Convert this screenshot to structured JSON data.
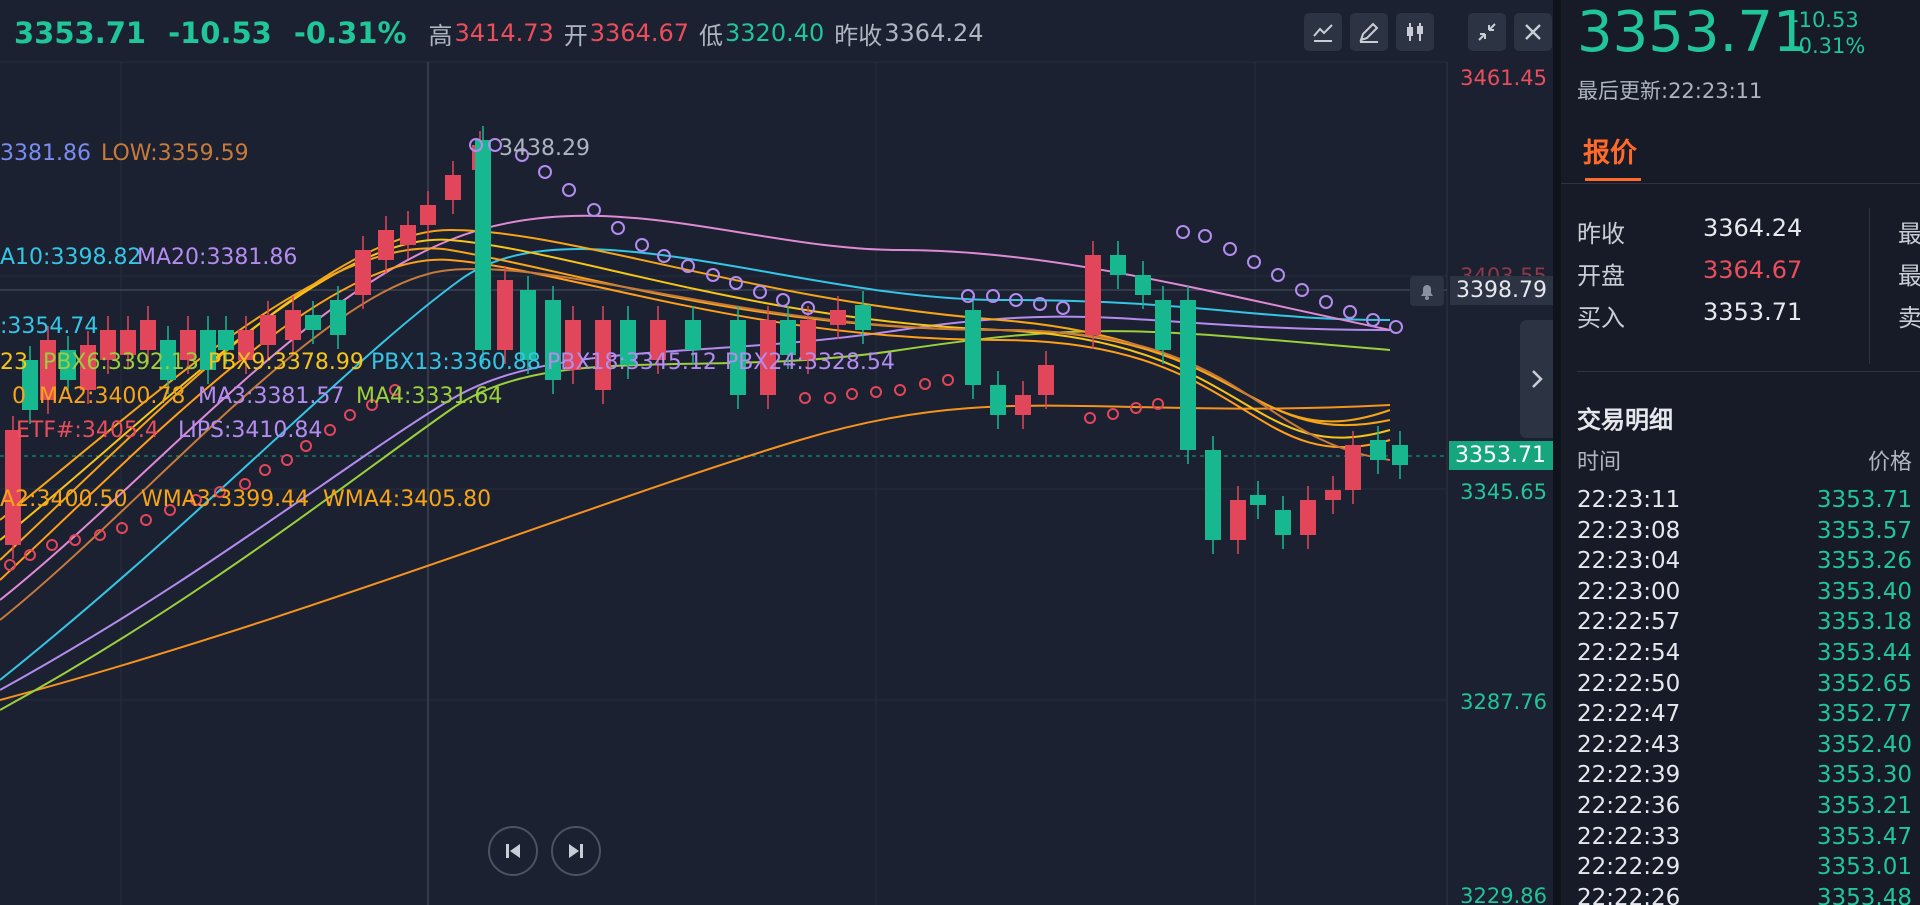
{
  "header": {
    "price": "3353.71",
    "change": "-10.53",
    "change_pct": "-0.31%",
    "high_label": "高",
    "high": "3414.73",
    "open_label": "开",
    "open": "3364.67",
    "low_label": "低",
    "low": "3320.40",
    "prev_label": "昨收",
    "prev": "3364.24"
  },
  "toolbar": {
    "icons": [
      "indicator-icon",
      "draw-pen-icon",
      "candlestick-icon",
      "collapse-icon",
      "close-icon"
    ]
  },
  "legends": {
    "high": "3381.86",
    "low": "LOW:3359.59",
    "ma10": "A10:3398.82",
    "ma20": "MA20:3381.86",
    "ma_partial": ":3354.74",
    "pbx_prefix": "23",
    "pbx6": "PBX6:3392.13",
    "pbx9": "PBX9:3378.99",
    "pbx13": "PBX13:3360.88",
    "pbx18": "PBX18:3345.12",
    "pbx24": "PBX24:3328.54",
    "ma2_prefix": "0",
    "ma2": "MA2:3400.78",
    "ma3": "MA3:3381.57",
    "ma4": "MA4:3331.64",
    "sar": "ETF#:3405.4",
    "lips": "LIPS:3410.84",
    "wma2": "A2:3400.50",
    "wma3": "WMA3:3399.44",
    "wma4": "WMA4:3405.80",
    "peak": "3438.29"
  },
  "price_axis": {
    "p1": "3461.45",
    "p2": "3403.55",
    "p3": "3345.65",
    "p4": "3287.76",
    "p5": "3229.86",
    "crosshair": "3398.79",
    "current": "3353.71"
  },
  "colors": {
    "up": "#21c59a",
    "down": "#ea4e5c",
    "bg": "#1b2130",
    "accent": "#ff6a2a"
  },
  "right": {
    "price": "3353.71",
    "change": "-10.53",
    "change_pct": "-0.31%",
    "updated": "最后更新:22:23:11",
    "tab": "报价",
    "quotes": [
      {
        "label": "昨收",
        "value": "3364.24",
        "cut": "最"
      },
      {
        "label": "开盘",
        "value": "3364.67",
        "cut": "最"
      },
      {
        "label": "买入",
        "value": "3353.71",
        "cut": "卖"
      }
    ],
    "trades_title": "交易明细",
    "col_time": "时间",
    "col_price": "价格",
    "trades": [
      {
        "t": "22:23:11",
        "p": "3353.71"
      },
      {
        "t": "22:23:08",
        "p": "3353.57"
      },
      {
        "t": "22:23:04",
        "p": "3353.26"
      },
      {
        "t": "22:23:00",
        "p": "3353.40"
      },
      {
        "t": "22:22:57",
        "p": "3353.18"
      },
      {
        "t": "22:22:54",
        "p": "3353.44"
      },
      {
        "t": "22:22:50",
        "p": "3352.65"
      },
      {
        "t": "22:22:47",
        "p": "3352.77"
      },
      {
        "t": "22:22:43",
        "p": "3352.40"
      },
      {
        "t": "22:22:39",
        "p": "3353.30"
      },
      {
        "t": "22:22:36",
        "p": "3353.21"
      },
      {
        "t": "22:22:33",
        "p": "3353.47"
      },
      {
        "t": "22:22:29",
        "p": "3353.01"
      },
      {
        "t": "22:22:26",
        "p": "3353.48"
      }
    ]
  }
}
